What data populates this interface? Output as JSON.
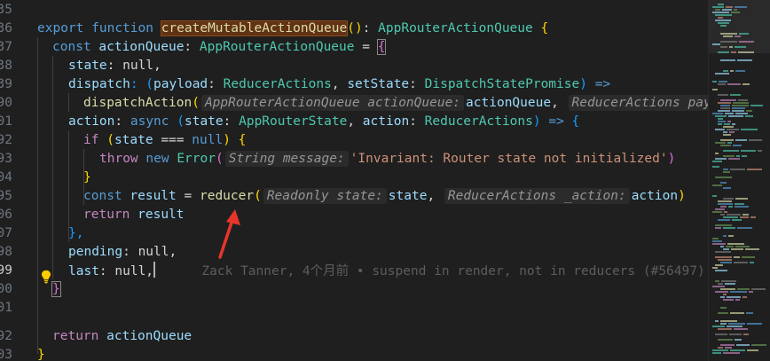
{
  "gutter": {
    "line_numbers": [
      "35",
      "36",
      "37",
      "38",
      "39",
      "90",
      "01",
      "92",
      "93",
      "04",
      "95",
      "06",
      "07",
      "98",
      "99",
      "00",
      "01",
      "92",
      "03"
    ],
    "active_index": 14
  },
  "code": {
    "l0": {
      "kw_export": "export",
      "kw_function": "function",
      "fn_name": "createMutableActionQueue",
      "paren": "()",
      "colon": ":",
      "ret_type": "AppRouterActionQueue",
      "brace": "{"
    },
    "l1": {
      "kw_const": "const",
      "var": "actionQueue",
      "colon": ":",
      "type": "AppRouterActionQueue",
      "eq": "=",
      "brace": "{"
    },
    "l2": {
      "prop": "state",
      "rest": ": null,"
    },
    "l3": {
      "prop": "dispatch",
      "c1": ": (",
      "p1": "payload",
      "c2": ":",
      "t1": "ReducerActions",
      "c3": ",",
      "p2": "setState",
      "c4": ":",
      "t2": "DispatchStatePromise",
      "c5": ")",
      "arrow": "=>"
    },
    "l4": {
      "fn": "dispatchAction",
      "paren": "(",
      "hint1": "AppRouterActionQueue actionQueue:",
      "arg1": "actionQueue",
      "comma": ",",
      "hint2": "ReducerActions pay"
    },
    "l5": {
      "prop": "action",
      "c1": ":",
      "kw_async": "async",
      "paren": "(",
      "p1": "state",
      "c2": ":",
      "t1": "AppRouterState",
      "c3": ",",
      "p2": "action",
      "c4": ":",
      "t2": "ReducerActions",
      "c5": ")",
      "arrow": "=>",
      "brace": "{"
    },
    "l6": {
      "kw_if": "if",
      "paren": "(",
      "var": "state",
      "op": "===",
      "kw_null": "null",
      "paren2": ")",
      "brace": "{"
    },
    "l7": {
      "kw_throw": "throw",
      "kw_new": "new",
      "cls": "Error",
      "paren": "(",
      "hint": "String message:",
      "str": "'Invariant: Router state not initialized'",
      "paren2": ")"
    },
    "l8": {
      "brace": "}"
    },
    "l9": {
      "kw_const": "const",
      "var": "result",
      "eq": "=",
      "fn": "reducer",
      "paren": "(",
      "hint1": "Readonly state:",
      "arg1": "state",
      "comma": ",",
      "hint2": "ReducerActions _action:",
      "arg2": "action",
      "paren2": ")"
    },
    "l10": {
      "kw_return": "return",
      "var": "result"
    },
    "l11": {
      "text": "},"
    },
    "l12": {
      "prop": "pending",
      "rest": ": null,"
    },
    "l13": {
      "prop": "last",
      "rest": ": null,",
      "blame": "Zack Tanner, 4个月前 • suspend in render, not in reducers (#56497)"
    },
    "l14": {
      "brace": "}"
    },
    "l15": {
      "kw_return": "return",
      "var": "actionQueue"
    },
    "l16": {
      "brace": "}"
    }
  },
  "icons": {
    "lightbulb": "lightbulb-icon",
    "annotation_arrow": "red-arrow"
  },
  "colors": {
    "background": "#1f1f1f",
    "keyword": "#569cd6",
    "function": "#dcdcaa",
    "type": "#4ec9b0",
    "variable": "#9cdcfe",
    "string": "#ce9178",
    "arrow": "#e8352c"
  }
}
